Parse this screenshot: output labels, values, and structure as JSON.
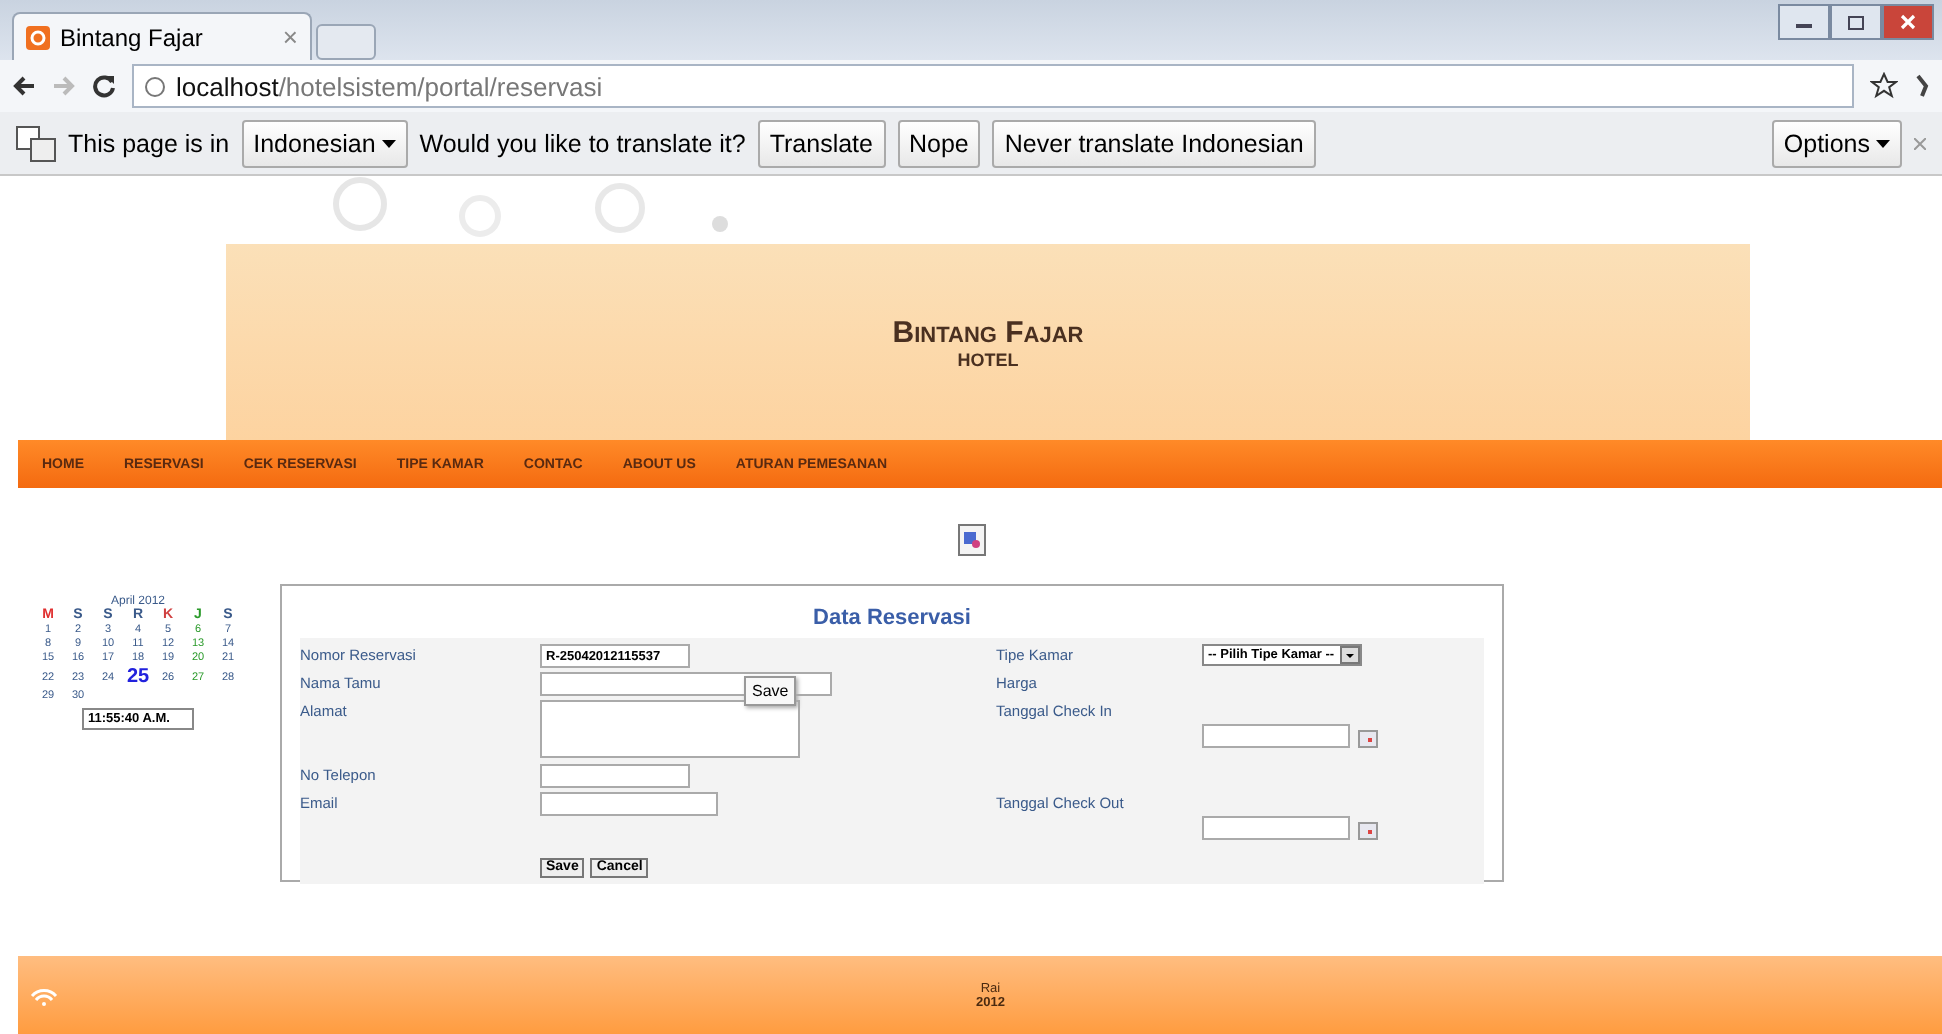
{
  "browser": {
    "tab": {
      "title": "Bintang Fajar",
      "close": "×",
      "selected": true
    },
    "address": {
      "host": "localhost",
      "path": "/hotelsistem/portal/reservasi"
    }
  },
  "translate_bar": {
    "prefix": "This page is in",
    "language": "Indonesian",
    "question": "Would you like to translate it?",
    "buttons": [
      "Translate",
      "Nope",
      "Never translate Indonesian"
    ],
    "options": "Options"
  },
  "header": {
    "title": "Bintang Fajar",
    "subtitle": "HOTEL"
  },
  "nav": [
    "HOME",
    "RESERVASI",
    "CEK RESERVASI",
    "TIPE KAMAR",
    "CONTAC",
    "ABOUT US",
    "ATURAN PEMESANAN"
  ],
  "calendar": {
    "month": "April 2012",
    "weekdays": [
      {
        "label": "M",
        "color": "#e03030",
        "highlight": false
      },
      {
        "label": "S",
        "color": "#3a5a8a",
        "highlight": false
      },
      {
        "label": "S",
        "color": "#3a5a8a",
        "highlight": false
      },
      {
        "label": "R",
        "color": "#3a5a8a",
        "highlight": false
      },
      {
        "label": "K",
        "color": "#d04040",
        "highlight": false
      },
      {
        "label": "J",
        "color": "#2a9a2a",
        "highlight": true
      },
      {
        "label": "S",
        "color": "#3a5a8a",
        "highlight": false
      }
    ],
    "weeks": [
      [
        {
          "label": "1",
          "selected": false
        },
        {
          "label": "2",
          "selected": false
        },
        {
          "label": "3",
          "selected": false
        },
        {
          "label": "4",
          "selected": false
        },
        {
          "label": "5",
          "selected": false
        },
        {
          "label": "6",
          "selected": false
        },
        {
          "label": "7",
          "selected": false
        }
      ],
      [
        {
          "label": "8",
          "selected": false
        },
        {
          "label": "9",
          "selected": false
        },
        {
          "label": "10",
          "selected": false
        },
        {
          "label": "11",
          "selected": false
        },
        {
          "label": "12",
          "selected": false
        },
        {
          "label": "13",
          "selected": false
        },
        {
          "label": "14",
          "selected": false
        }
      ],
      [
        {
          "label": "15",
          "selected": false
        },
        {
          "label": "16",
          "selected": false
        },
        {
          "label": "17",
          "selected": false
        },
        {
          "label": "18",
          "selected": false
        },
        {
          "label": "19",
          "selected": false
        },
        {
          "label": "20",
          "selected": false
        },
        {
          "label": "21",
          "selected": false
        }
      ],
      [
        {
          "label": "22",
          "selected": false
        },
        {
          "label": "23",
          "selected": false
        },
        {
          "label": "24",
          "selected": false
        },
        {
          "label": "25",
          "selected": true
        },
        {
          "label": "26",
          "selected": false
        },
        {
          "label": "27",
          "selected": false
        },
        {
          "label": "28",
          "selected": false
        }
      ],
      [
        {
          "label": "29",
          "selected": false
        },
        {
          "label": "30",
          "selected": false
        }
      ]
    ],
    "time": "11:55:40 A.M."
  },
  "form": {
    "title": "Data Reservasi",
    "left": [
      {
        "label": "Nomor Reservasi",
        "kind": "input",
        "value": "R-25042012115537"
      },
      {
        "label": "Nama Tamu",
        "kind": "input_wide"
      },
      {
        "label": "Alamat",
        "kind": "textarea"
      },
      {
        "label": "No Telepon",
        "kind": "input"
      },
      {
        "label": "Email",
        "kind": "input_mid"
      }
    ],
    "right": [
      {
        "label": "Tipe Kamar",
        "kind": "select",
        "value": "-- Pilih Tipe Kamar --"
      },
      {
        "label": "Harga",
        "kind": "none"
      },
      {
        "label": "Tanggal Check In",
        "kind": "date"
      },
      {
        "label": "Tanggal Check Out",
        "kind": "date"
      }
    ],
    "buttons": [
      "Save",
      "Cancel"
    ],
    "tooltip": "Save"
  },
  "footer": {
    "line_1": "Rai",
    "line_2": "2012"
  }
}
